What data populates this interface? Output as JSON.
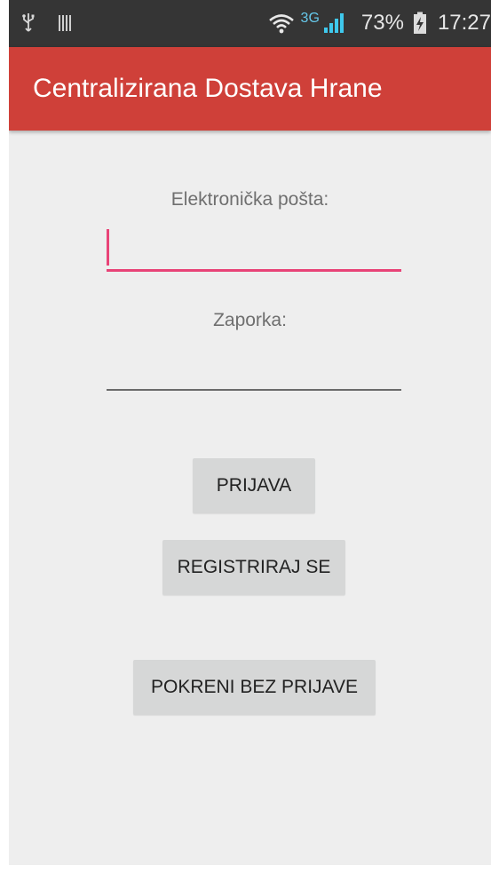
{
  "status_bar": {
    "usb_icon": "usb-icon",
    "notification_icon": "barcode-icon",
    "wifi_icon": "wifi-icon",
    "network_type": "3G",
    "signal_icon": "signal-icon",
    "battery_percent": "73%",
    "battery_icon": "battery-charging-icon",
    "time": "17:27"
  },
  "app_bar": {
    "title": "Centralizirana Dostava Hrane",
    "color": "#cf4039"
  },
  "form": {
    "email": {
      "label": "Elektronička pošta:",
      "value": "",
      "placeholder": "",
      "focused": true,
      "accent_color": "#e84377"
    },
    "password": {
      "label": "Zaporka:",
      "value": "",
      "placeholder": ""
    }
  },
  "buttons": {
    "login": "PRIJAVA",
    "register": "REGISTRIRAJ SE",
    "guest": "POKRENI BEZ PRIJAVE"
  }
}
